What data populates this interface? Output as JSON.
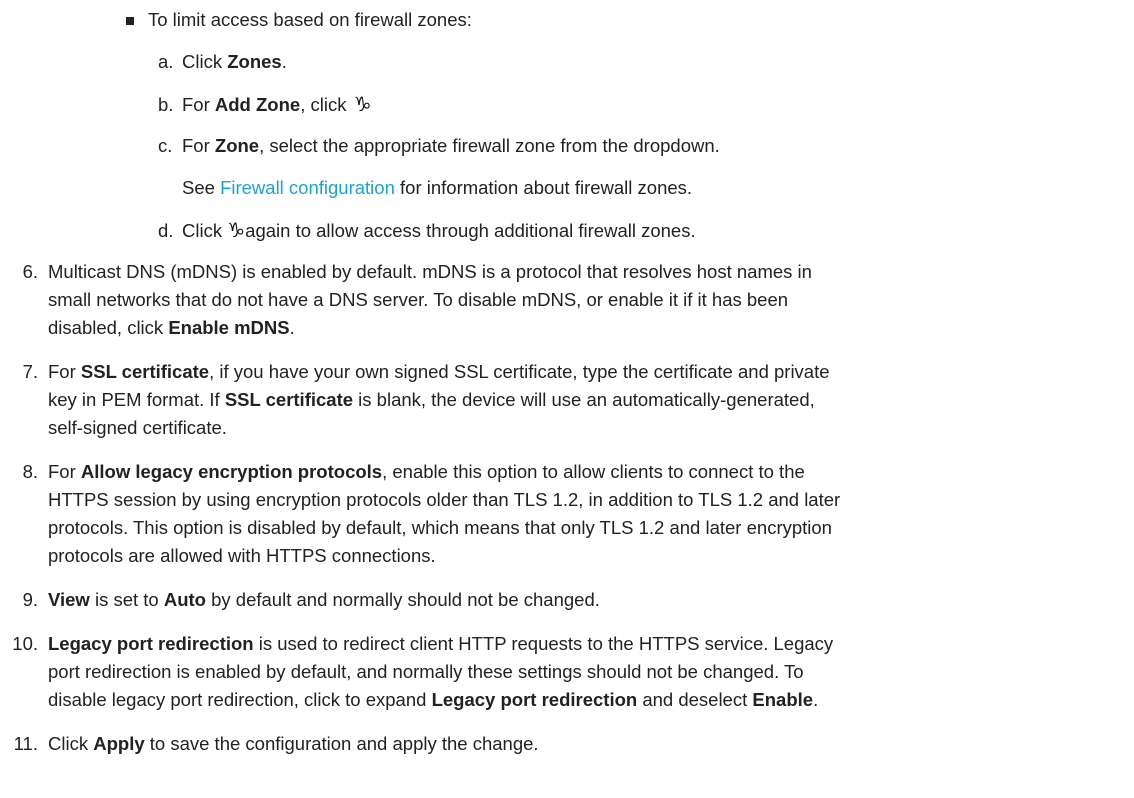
{
  "bullet": "To limit access based on firewall zones:",
  "sub": {
    "a": {
      "letter": "a.",
      "pre": "Click ",
      "bold": "Zones",
      "post": "."
    },
    "b": {
      "letter": "b.",
      "pre": "For ",
      "bold": "Add Zone",
      "post": ", click "
    },
    "c": {
      "letter": "c.",
      "pre": "For ",
      "bold": "Zone",
      "post": ", select the appropriate firewall zone from the dropdown."
    },
    "c_cont_pre": "See ",
    "c_cont_link": "Firewall configuration",
    "c_cont_post": " for information about firewall zones.",
    "d": {
      "letter": "d.",
      "pre": "Click ",
      "post": "again to allow access through additional firewall zones."
    }
  },
  "icons": {
    "add": "add-icon"
  },
  "steps": {
    "s6": {
      "num": "6.",
      "l1": "Multicast DNS (mDNS) is enabled by default. mDNS is a protocol that resolves host names in",
      "l2": "small networks that do not have a DNS server. To disable mDNS, or enable it if it has been",
      "l3_pre": "disabled, click ",
      "l3_bold": "Enable mDNS",
      "l3_post": "."
    },
    "s7": {
      "num": "7.",
      "l1_pre": "For ",
      "l1_bold": "SSL certificate",
      "l1_post": ", if you have your own signed SSL certificate, type the certificate and private",
      "l2_pre": "key in PEM format. If ",
      "l2_bold": "SSL certificate",
      "l2_post": " is blank, the device will use an automatically-generated,",
      "l3": "self-signed certificate."
    },
    "s8": {
      "num": "8.",
      "l1_pre": "For ",
      "l1_bold": "Allow legacy encryption protocols",
      "l1_post": ", enable this option to allow clients to connect to the",
      "l2": "HTTPS session by using encryption protocols older than TLS 1.2, in addition to TLS 1.2 and later",
      "l3": "protocols. This option is disabled by default, which means that only TLS 1.2 and later encryption",
      "l4": "protocols are allowed with HTTPS connections."
    },
    "s9": {
      "num": "9.",
      "b1": "View",
      "mid": " is set to ",
      "b2": "Auto",
      "post": " by default and normally should not be changed."
    },
    "s10": {
      "num": "10.",
      "l1_bold": "Legacy port redirection",
      "l1_post": " is used to redirect client HTTP requests to the HTTPS service. Legacy",
      "l2": "port redirection is enabled by default, and normally these settings should not be changed. To",
      "l3_pre": "disable legacy port redirection, click to expand ",
      "l3_bold1": "Legacy port redirection",
      "l3_mid": " and deselect ",
      "l3_bold2": "Enable",
      "l3_post": "."
    },
    "s11": {
      "num": "11.",
      "pre": "Click ",
      "bold": "Apply",
      "post": " to save the configuration and apply the change."
    }
  }
}
